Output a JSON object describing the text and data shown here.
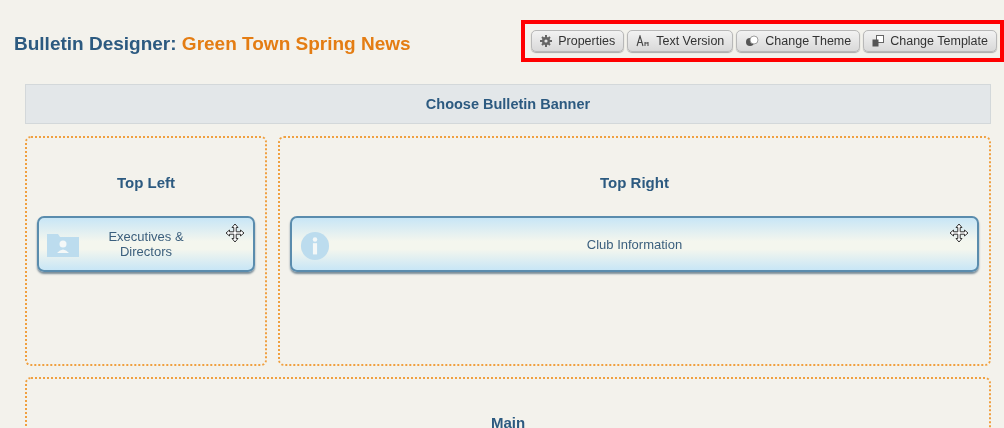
{
  "header": {
    "title": "Bulletin Designer:",
    "bulletin_name": "Green Town Spring News"
  },
  "toolbar": [
    {
      "kind": "gear",
      "label": "Properties"
    },
    {
      "kind": "text",
      "label": "Text Version"
    },
    {
      "kind": "theme",
      "label": "Change Theme"
    },
    {
      "kind": "template",
      "label": "Change Template"
    }
  ],
  "banner": {
    "label": "Choose Bulletin Banner"
  },
  "zones": [
    {
      "title": "Top Left",
      "widgets": [
        {
          "kind": "folder",
          "label": "Executives & Directors"
        }
      ]
    },
    {
      "title": "Top Right",
      "widgets": [
        {
          "kind": "info",
          "label": "Club Information"
        }
      ]
    }
  ],
  "main": {
    "title": "Main"
  }
}
